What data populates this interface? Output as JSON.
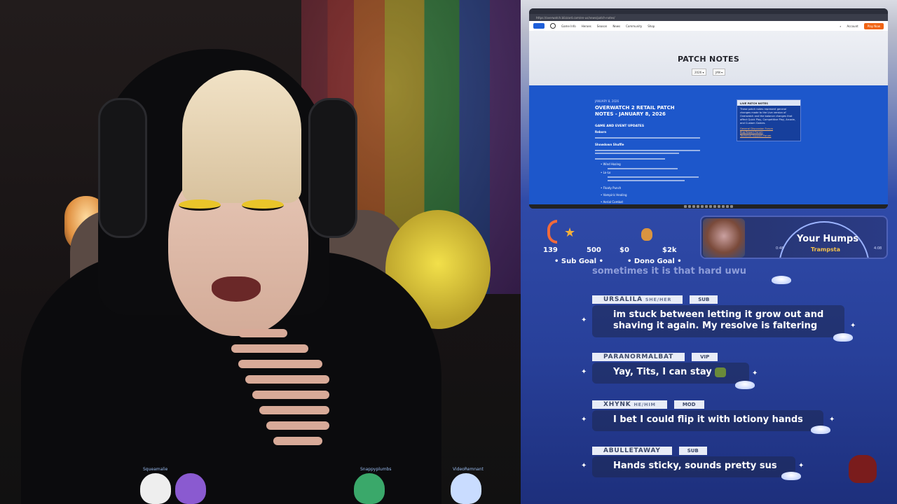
{
  "webcam": {
    "viewers": [
      "Squeamalie",
      "",
      "Snappyplumbs",
      "VideoRemnant"
    ]
  },
  "browser": {
    "url": "https://overwatch.blizzard.com/en-us/news/patch-notes/",
    "nav": [
      "Game Info",
      "Heroes",
      "Season",
      "News",
      "Community",
      "Shop"
    ],
    "account_label": "Account",
    "play_label": "Play Now",
    "page_title": "PATCH NOTES",
    "year_select": "2026",
    "month_select": "JAN",
    "article_date": "JANUARY 8, 2026",
    "article_title": "OVERWATCH 2 RETAIL PATCH NOTES - JANUARY 8, 2026",
    "section_heading": "GAME AND EVENT UPDATES",
    "sub_heading": "Reborn",
    "sub_heading2": "Showdown Shuffle",
    "bullets": [
      "Wind Hazing",
      "Lo-Lo",
      "Floaty Punch",
      "Vampiric Healing",
      "Aerial Combat"
    ],
    "livebox": {
      "header": "LIVE PATCH NOTES",
      "body": "These patch notes represent general changes made to the Live version of Overwatch and the balance changes that affect Quick Play, Competitive Play, Arcade, and Custom Games.",
      "links": [
        "General Discussion Forum",
        "Bug Report Forum",
        "Technical Support Forum"
      ]
    }
  },
  "goals": {
    "sub": {
      "current": "139",
      "target": "500",
      "label": "• Sub Goal •"
    },
    "dono": {
      "current": "$0",
      "target": "$2k",
      "label": "• Dono Goal •"
    }
  },
  "now_playing": {
    "title": "Your Humps",
    "artist": "Trampsta",
    "elapsed": "0:48",
    "duration": "4:08"
  },
  "chat": {
    "partial": "sometimes it is that hard uwu",
    "messages": [
      {
        "user": "URSALILA",
        "pronouns": "SHE/HER",
        "role": "SUB",
        "text": "im stuck between letting it grow out and shaving it again. My resolve is faltering"
      },
      {
        "user": "PARANORMALBAT",
        "pronouns": "",
        "role": "VIP",
        "text": "Yay, Tits, I can stay"
      },
      {
        "user": "XHYNK",
        "pronouns": "HE/HIM",
        "role": "MOD",
        "text": "I bet I could flip it with lotiony hands"
      },
      {
        "user": "ABULLETAWAY",
        "pronouns": "",
        "role": "SUB",
        "text": "Hands sticky, sounds pretty sus"
      }
    ]
  }
}
